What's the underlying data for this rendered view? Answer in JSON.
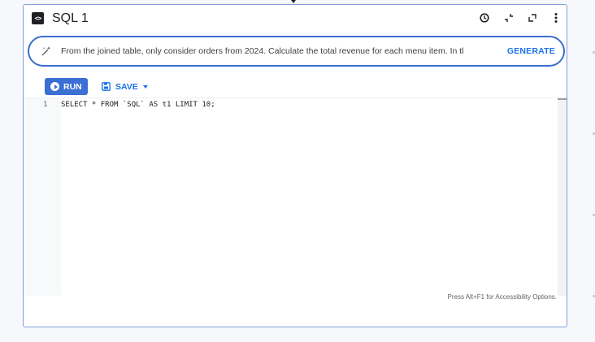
{
  "window": {
    "title": "SQL 1",
    "icons": [
      "code-brackets-icon",
      "history-clock-icon",
      "collapse-icon",
      "expand-icon",
      "more-vert-icon"
    ]
  },
  "prompt": {
    "text": "From the joined table, only consider orders from 2024. Calculate the total revenue for each menu item. In tl",
    "generate_label": "GENERATE",
    "icon": "wand-icon"
  },
  "toolbar": {
    "run_label": "RUN",
    "save_label": "SAVE"
  },
  "editor": {
    "lines": [
      {
        "number": "1",
        "code": "SELECT * FROM `SQL` AS t1 LIMIT 10;"
      }
    ],
    "accessibility_note": "Press Alt+F1 for Accessibility Options."
  },
  "colors": {
    "accent": "#1a73e8",
    "run_button": "#3b6fd4",
    "prompt_border": "#3a6ecf",
    "panel_border": "#7f9fd9"
  }
}
